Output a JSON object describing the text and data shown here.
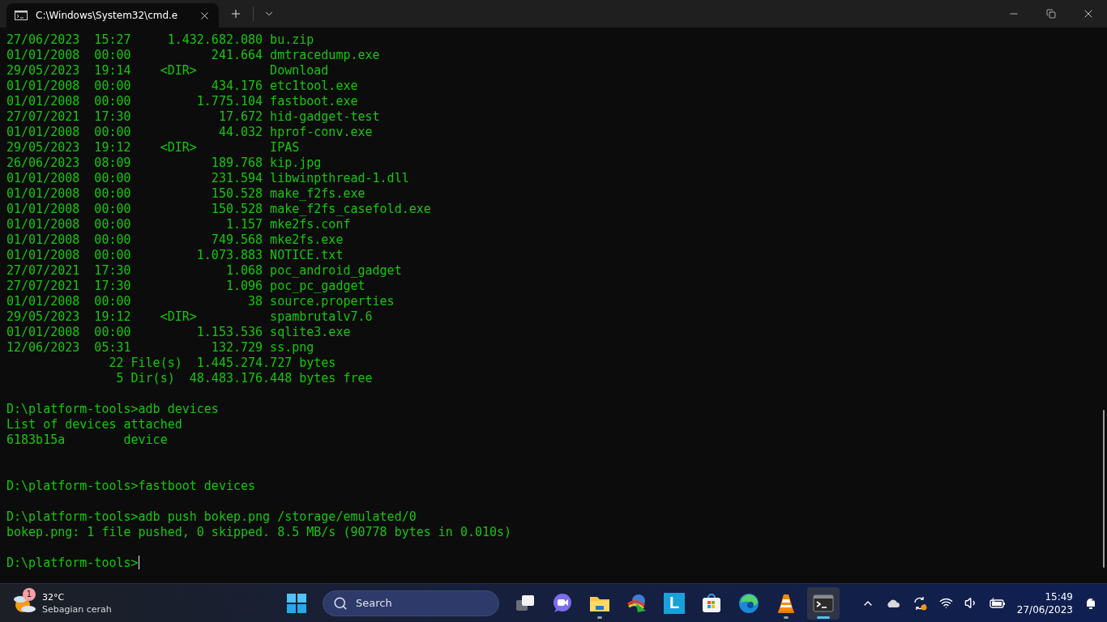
{
  "window": {
    "tab_title": "C:\\Windows\\System32\\cmd.e"
  },
  "terminal": {
    "lines": [
      {
        "kind": "text",
        "text": "27/06/2023  15:27     1.432.682.080 bu.zip"
      },
      {
        "kind": "text",
        "text": "01/01/2008  00:00           241.664 dmtracedump.exe"
      },
      {
        "kind": "text",
        "text": "29/05/2023  19:14    <DIR>          Download"
      },
      {
        "kind": "text",
        "text": "01/01/2008  00:00           434.176 etc1tool.exe"
      },
      {
        "kind": "text",
        "text": "01/01/2008  00:00         1.775.104 fastboot.exe"
      },
      {
        "kind": "text",
        "text": "27/07/2021  17:30            17.672 hid-gadget-test"
      },
      {
        "kind": "text",
        "text": "01/01/2008  00:00            44.032 hprof-conv.exe"
      },
      {
        "kind": "text",
        "text": "29/05/2023  19:12    <DIR>          IPAS"
      },
      {
        "kind": "text",
        "text": "26/06/2023  08:09           189.768 kip.jpg"
      },
      {
        "kind": "text",
        "text": "01/01/2008  00:00           231.594 libwinpthread-1.dll"
      },
      {
        "kind": "text",
        "text": "01/01/2008  00:00           150.528 make_f2fs.exe"
      },
      {
        "kind": "text",
        "text": "01/01/2008  00:00           150.528 make_f2fs_casefold.exe"
      },
      {
        "kind": "text",
        "text": "01/01/2008  00:00             1.157 mke2fs.conf"
      },
      {
        "kind": "text",
        "text": "01/01/2008  00:00           749.568 mke2fs.exe"
      },
      {
        "kind": "text",
        "text": "01/01/2008  00:00         1.073.883 NOTICE.txt"
      },
      {
        "kind": "text",
        "text": "27/07/2021  17:30             1.068 poc_android_gadget"
      },
      {
        "kind": "text",
        "text": "27/07/2021  17:30             1.096 poc_pc_gadget"
      },
      {
        "kind": "text",
        "text": "01/01/2008  00:00                38 source.properties"
      },
      {
        "kind": "text",
        "text": "29/05/2023  19:12    <DIR>          spambrutalv7.6"
      },
      {
        "kind": "text",
        "text": "01/01/2008  00:00         1.153.536 sqlite3.exe"
      },
      {
        "kind": "text",
        "text": "12/06/2023  05:31           132.729 ss.png"
      },
      {
        "kind": "text",
        "text": "              22 File(s)  1.445.274.727 bytes"
      },
      {
        "kind": "text",
        "text": "               5 Dir(s)  48.483.176.448 bytes free"
      },
      {
        "kind": "blank"
      },
      {
        "kind": "text",
        "text": "D:\\platform-tools>adb devices"
      },
      {
        "kind": "text",
        "text": "List of devices attached"
      },
      {
        "kind": "text",
        "text": "6183b15a        device"
      },
      {
        "kind": "blank"
      },
      {
        "kind": "blank"
      },
      {
        "kind": "text",
        "text": "D:\\platform-tools>fastboot devices"
      },
      {
        "kind": "blank"
      },
      {
        "kind": "text",
        "text": "D:\\platform-tools>adb push bokep.png /storage/emulated/0"
      },
      {
        "kind": "text",
        "text": "bokep.png: 1 file pushed, 0 skipped. 8.5 MB/s (90778 bytes in 0.010s)"
      },
      {
        "kind": "blank"
      },
      {
        "kind": "prompt",
        "text": "D:\\platform-tools>"
      }
    ]
  },
  "taskbar": {
    "weather": {
      "badge": "1",
      "temperature": "32°C",
      "condition": "Sebagian cerah"
    },
    "search": {
      "placeholder": "Search"
    },
    "apps": [
      {
        "kind": "task-view",
        "running": false,
        "selected": false
      },
      {
        "kind": "video-chat",
        "running": false,
        "selected": false
      },
      {
        "kind": "folder",
        "running": true,
        "selected": false
      },
      {
        "kind": "download-globe",
        "running": false,
        "selected": false
      },
      {
        "kind": "letter-tile",
        "label": "L",
        "running": false,
        "selected": false
      },
      {
        "kind": "store",
        "running": false,
        "selected": false
      },
      {
        "kind": "browser",
        "running": false,
        "selected": false
      },
      {
        "kind": "cone",
        "running": true,
        "selected": false
      },
      {
        "kind": "terminal",
        "running": true,
        "selected": true
      }
    ],
    "time": "15:49",
    "date": "27/06/2023"
  }
}
